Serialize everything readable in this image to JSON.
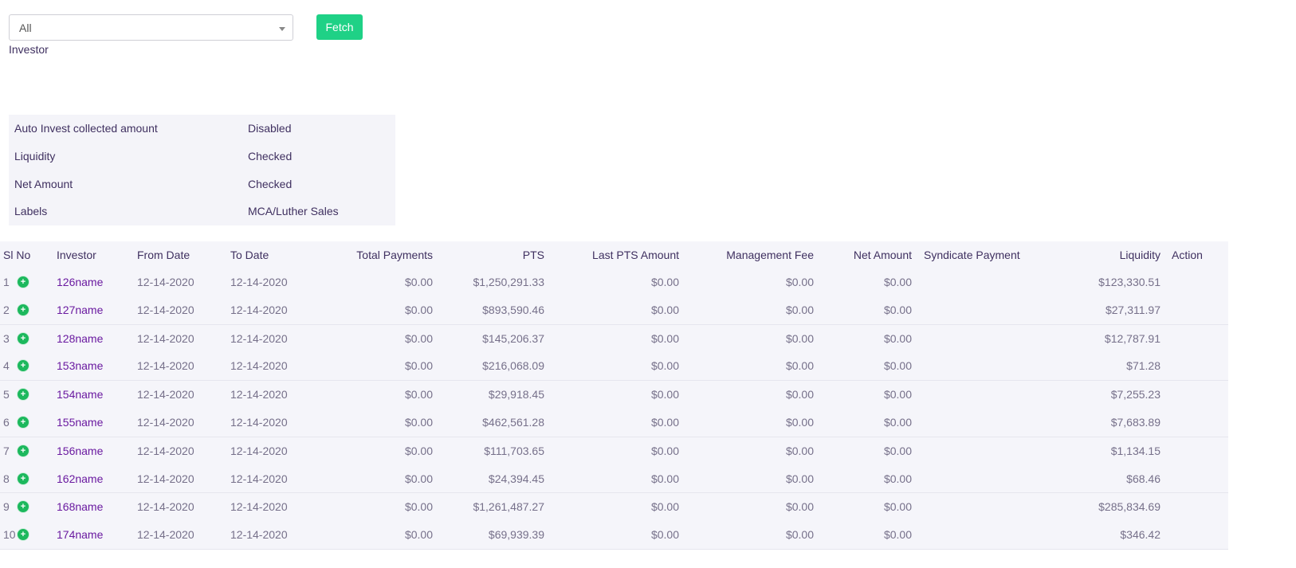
{
  "filter": {
    "selected_value": "All",
    "label": "Investor",
    "fetch_label": "Fetch"
  },
  "summary": [
    {
      "label": "Auto Invest collected amount",
      "value": "Disabled"
    },
    {
      "label": "Liquidity",
      "value": "Checked"
    },
    {
      "label": "Net Amount",
      "value": "Checked"
    },
    {
      "label": "Labels",
      "value": "MCA/Luther Sales"
    }
  ],
  "table": {
    "headers": {
      "sl_no": "Sl No",
      "investor": "Investor",
      "from_date": "From Date",
      "to_date": "To Date",
      "total_payments": "Total Payments",
      "pts": "PTS",
      "last_pts_amount": "Last PTS Amount",
      "management_fee": "Management Fee",
      "net_amount": "Net Amount",
      "syndicate_payment": "Syndicate Payment",
      "liquidity": "Liquidity",
      "action": "Action"
    },
    "rows": [
      {
        "sl": "1",
        "investor": "126name",
        "from": "12-14-2020",
        "to": "12-14-2020",
        "total": "$0.00",
        "pts": "$1,250,291.33",
        "last_pts": "$0.00",
        "mgmt": "$0.00",
        "net": "$0.00",
        "syndicate": "",
        "liquidity": "$123,330.51"
      },
      {
        "sl": "2",
        "investor": "127name",
        "from": "12-14-2020",
        "to": "12-14-2020",
        "total": "$0.00",
        "pts": "$893,590.46",
        "last_pts": "$0.00",
        "mgmt": "$0.00",
        "net": "$0.00",
        "syndicate": "",
        "liquidity": "$27,311.97"
      },
      {
        "sl": "3",
        "investor": "128name",
        "from": "12-14-2020",
        "to": "12-14-2020",
        "total": "$0.00",
        "pts": "$145,206.37",
        "last_pts": "$0.00",
        "mgmt": "$0.00",
        "net": "$0.00",
        "syndicate": "",
        "liquidity": "$12,787.91"
      },
      {
        "sl": "4",
        "investor": "153name",
        "from": "12-14-2020",
        "to": "12-14-2020",
        "total": "$0.00",
        "pts": "$216,068.09",
        "last_pts": "$0.00",
        "mgmt": "$0.00",
        "net": "$0.00",
        "syndicate": "",
        "liquidity": "$71.28"
      },
      {
        "sl": "5",
        "investor": "154name",
        "from": "12-14-2020",
        "to": "12-14-2020",
        "total": "$0.00",
        "pts": "$29,918.45",
        "last_pts": "$0.00",
        "mgmt": "$0.00",
        "net": "$0.00",
        "syndicate": "",
        "liquidity": "$7,255.23"
      },
      {
        "sl": "6",
        "investor": "155name",
        "from": "12-14-2020",
        "to": "12-14-2020",
        "total": "$0.00",
        "pts": "$462,561.28",
        "last_pts": "$0.00",
        "mgmt": "$0.00",
        "net": "$0.00",
        "syndicate": "",
        "liquidity": "$7,683.89"
      },
      {
        "sl": "7",
        "investor": "156name",
        "from": "12-14-2020",
        "to": "12-14-2020",
        "total": "$0.00",
        "pts": "$111,703.65",
        "last_pts": "$0.00",
        "mgmt": "$0.00",
        "net": "$0.00",
        "syndicate": "",
        "liquidity": "$1,134.15"
      },
      {
        "sl": "8",
        "investor": "162name",
        "from": "12-14-2020",
        "to": "12-14-2020",
        "total": "$0.00",
        "pts": "$24,394.45",
        "last_pts": "$0.00",
        "mgmt": "$0.00",
        "net": "$0.00",
        "syndicate": "",
        "liquidity": "$68.46"
      },
      {
        "sl": "9",
        "investor": "168name",
        "from": "12-14-2020",
        "to": "12-14-2020",
        "total": "$0.00",
        "pts": "$1,261,487.27",
        "last_pts": "$0.00",
        "mgmt": "$0.00",
        "net": "$0.00",
        "syndicate": "",
        "liquidity": "$285,834.69"
      },
      {
        "sl": "10",
        "investor": "174name",
        "from": "12-14-2020",
        "to": "12-14-2020",
        "total": "$0.00",
        "pts": "$69,939.39",
        "last_pts": "$0.00",
        "mgmt": "$0.00",
        "net": "$0.00",
        "syndicate": "",
        "liquidity": "$346.42"
      }
    ],
    "row_icon": "plus-circle-icon"
  },
  "colors": {
    "accent_green": "#1fd186",
    "link_purple": "#6a1aa0",
    "table_bg": "#f5f5fa"
  }
}
